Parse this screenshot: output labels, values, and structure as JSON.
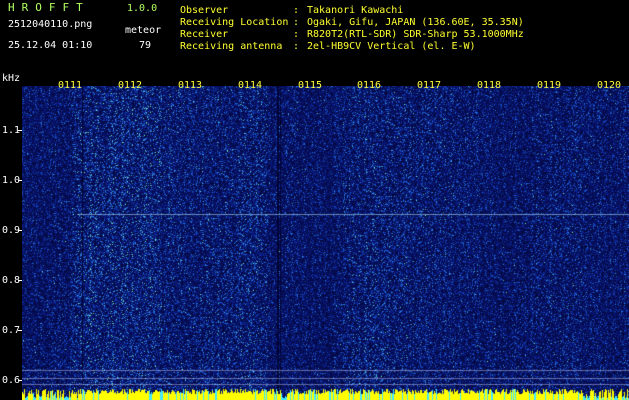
{
  "app": {
    "title": "HROFFT",
    "version": "1.0.0"
  },
  "file_name": "2512040110.png",
  "meteor_label": "meteor",
  "meteor_count": "79",
  "datetime": "25.12.04 01:10",
  "info": [
    {
      "label": "Observer",
      "value": "Takanori Kawachi"
    },
    {
      "label": "Receiving Location",
      "value": "Ogaki, Gifu, JAPAN (136.60E, 35.35N)"
    },
    {
      "label": "Receiver",
      "value": "R820T2(RTL-SDR) SDR-Sharp 53.1000MHz"
    },
    {
      "label": "Receiving antenna",
      "value": "2el-HB9CV Vertical (el. E-W)"
    }
  ],
  "colon": ":",
  "spectrogram": {
    "y_axis_unit": "kHz",
    "y_ticks": [
      "1.1",
      "1.0",
      "0.9",
      "0.8",
      "0.7",
      "0.6"
    ],
    "time_labels": [
      "0111",
      "0112",
      "0113",
      "0114",
      "0115",
      "0116",
      "0117",
      "0118",
      "0119",
      "0120"
    ],
    "colors": {
      "low": "#0a1a8a",
      "mid": "#1e6be0",
      "high": "#7ff0c0",
      "peak": "#ffff00",
      "carrier": "#b0e8ff"
    }
  }
}
